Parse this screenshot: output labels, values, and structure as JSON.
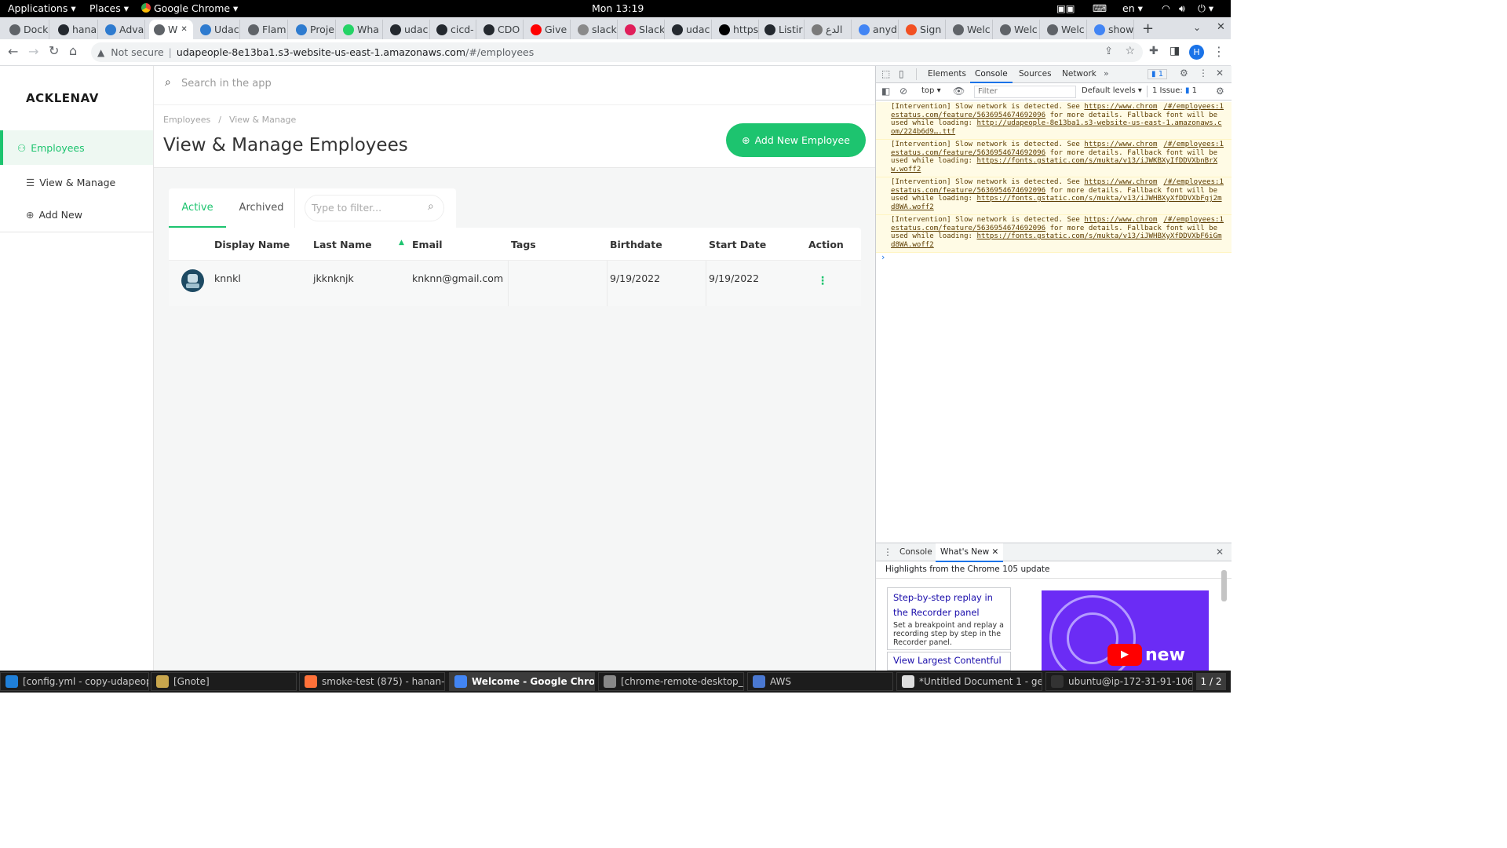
{
  "topbar": {
    "applications": "Applications",
    "places": "Places",
    "browser": "Google Chrome",
    "clock": "Mon 13:19",
    "lang": "en"
  },
  "tabs": [
    {
      "label": "Dock",
      "fav": "#5f6368"
    },
    {
      "label": "hana",
      "fav": "#24292f"
    },
    {
      "label": "Adva",
      "fav": "#2e7bcf"
    },
    {
      "label": "W",
      "fav": "#5f6368",
      "active": true
    },
    {
      "label": "Udac",
      "fav": "#2e7bcf"
    },
    {
      "label": "Flam",
      "fav": "#5f6368"
    },
    {
      "label": "Proje",
      "fav": "#2e7bcf"
    },
    {
      "label": "Wha",
      "fav": "#25d366"
    },
    {
      "label": "udac",
      "fav": "#24292f"
    },
    {
      "label": "cicd-",
      "fav": "#24292f"
    },
    {
      "label": "CDO",
      "fav": "#24292f"
    },
    {
      "label": "Give",
      "fav": "#ff0000"
    },
    {
      "label": "slack",
      "fav": "#8a8a8a"
    },
    {
      "label": "Slack",
      "fav": "#e01e5a"
    },
    {
      "label": "udac",
      "fav": "#24292f"
    },
    {
      "label": "https",
      "fav": "#000"
    },
    {
      "label": "Listir",
      "fav": "#24292f"
    },
    {
      "label": "الدع",
      "fav": "#7a7a7a"
    },
    {
      "label": "anyd",
      "fav": "#4285f4"
    },
    {
      "label": "Sign",
      "fav": "#f25022"
    },
    {
      "label": "Welc",
      "fav": "#5f6368"
    },
    {
      "label": "Welc",
      "fav": "#5f6368"
    },
    {
      "label": "Welc",
      "fav": "#5f6368"
    },
    {
      "label": "show",
      "fav": "#4285f4"
    }
  ],
  "address": {
    "security": "Not secure",
    "host": "udapeople-8e13ba1.s3-website-us-east-1.amazonaws.com",
    "path": "/#/employees",
    "profile": "H"
  },
  "app": {
    "logo": "ACKLENAV",
    "search_placeholder": "Search in the app",
    "sidebar": [
      {
        "label": "Employees"
      },
      {
        "label": "View & Manage"
      },
      {
        "label": "Add New"
      }
    ],
    "breadcrumb": [
      "Employees",
      "/",
      "View & Manage"
    ],
    "page_title": "View & Manage Employees",
    "add_button": "Add New Employee",
    "tab_active": "Active",
    "tab_archived": "Archived",
    "filter_placeholder": "Type to filter...",
    "columns": [
      "Display Name",
      "Last Name",
      "Email",
      "Tags",
      "Birthdate",
      "Start Date",
      "Action"
    ],
    "rows": [
      {
        "display": "knnkl",
        "last": "jkknknjk",
        "email": "knknn@gmail.com",
        "tags": "",
        "birth": "9/19/2022",
        "start": "9/19/2022"
      }
    ],
    "accent": "#1dc46f"
  },
  "devtools": {
    "tabs": [
      "Elements",
      "Console",
      "Sources",
      "Network"
    ],
    "badge": "1",
    "context": "top",
    "filter_placeholder": "Filter",
    "levels": "Default levels",
    "issues": "1 Issue:",
    "issues_count": "1",
    "messages": [
      {
        "pre": "[Intervention] Slow network is detected. See ",
        "link": "https://www.chromestatus.com/feature/5636954674692096",
        "post": " for more details. Fallback font will be used while loading: ",
        "res": "http://udapeople-8e13ba1.s3-website-us-east-1.amazonaws.com/224b6d9….ttf",
        "src": "/#/employees:1"
      },
      {
        "pre": "[Intervention] Slow network is detected. See ",
        "link": "https://www.chromestatus.com/feature/5636954674692096",
        "post": " for more details. Fallback font will be used while loading: ",
        "res": "https://fonts.gstatic.com/s/mukta/v13/iJWKBXyIfDDVXbnBrXw.woff2",
        "src": "/#/employees:1"
      },
      {
        "pre": "[Intervention] Slow network is detected. See ",
        "link": "https://www.chromestatus.com/feature/5636954674692096",
        "post": " for more details. Fallback font will be used while loading: ",
        "res": "https://fonts.gstatic.com/s/mukta/v13/iJWHBXyXfDDVXbFgj2md8WA.woff2",
        "src": "/#/employees:1"
      },
      {
        "pre": "[Intervention] Slow network is detected. See ",
        "link": "https://www.chromestatus.com/feature/5636954674692096",
        "post": " for more details. Fallback font will be used while loading: ",
        "res": "https://fonts.gstatic.com/s/mukta/v13/iJWHBXyXfDDVXbF6iGmd8WA.woff2",
        "src": "/#/employees:1"
      }
    ],
    "drawer_tabs": [
      "Console",
      "What's New"
    ],
    "highlights": "Highlights from the Chrome 105 update",
    "card1_title": "Step-by-step replay in the Recorder panel",
    "card1_body": "Set a breakpoint and replay a recording step by step in the Recorder panel.",
    "card2_title": "View Largest Contentful",
    "video_label": "new"
  },
  "taskbar": [
    {
      "label": "[config.yml - copy-udapeopl...",
      "icon": "#1f7fd8"
    },
    {
      "label": "[Gnote]",
      "icon": "#c8a64d"
    },
    {
      "label": "smoke-test (875) - hanan-hu...",
      "icon": "#ff7139"
    },
    {
      "label": "Welcome - Google Chrome",
      "icon": "#4285f4",
      "active": true
    },
    {
      "label": "[chrome-remote-desktop_cu...",
      "icon": "#888"
    },
    {
      "label": "AWS",
      "icon": "#4a78d1"
    },
    {
      "label": "*Untitled Document 1 - gedit",
      "icon": "#ddd"
    },
    {
      "label": "ubuntu@ip-172-31-91-106:...",
      "icon": "#333"
    }
  ],
  "workspace": "1 / 2"
}
